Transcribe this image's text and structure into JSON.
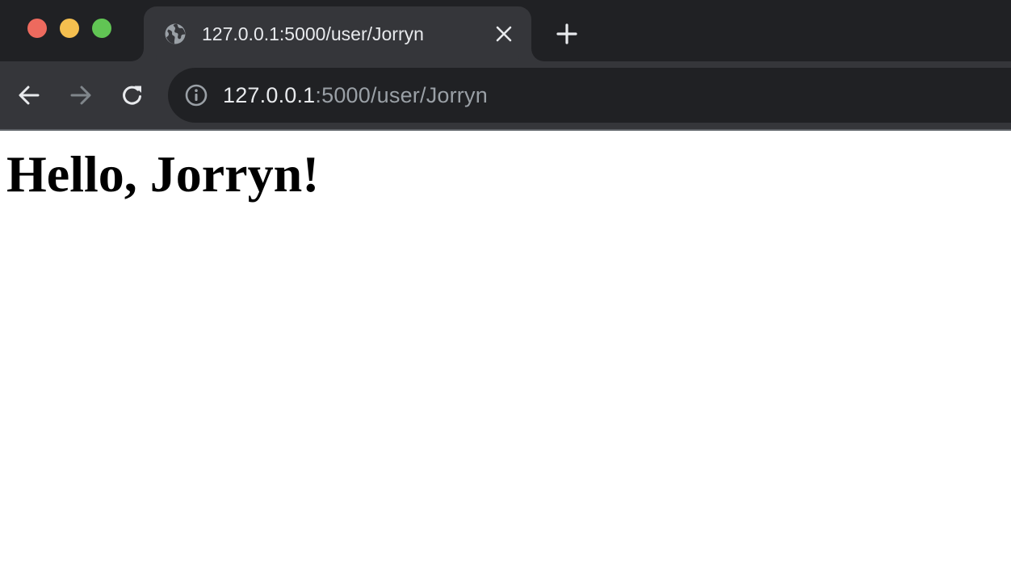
{
  "window": {
    "traffic_lights": {
      "close_color": "#ed6a5e",
      "minimize_color": "#f5bf4f",
      "maximize_color": "#61c554"
    }
  },
  "tab": {
    "title": "127.0.0.1:5000/user/Jorryn",
    "favicon": "globe-icon",
    "close_icon": "close-icon"
  },
  "new_tab": {
    "icon": "plus-icon"
  },
  "toolbar": {
    "back_icon": "arrow-left-icon",
    "forward_icon": "arrow-right-icon",
    "reload_icon": "reload-icon",
    "forward_enabled": false
  },
  "address_bar": {
    "info_icon": "info-icon",
    "url_host": "127.0.0.1",
    "url_rest": ":5000/user/Jorryn"
  },
  "page": {
    "heading": "Hello, Jorryn!"
  },
  "colors": {
    "chrome_dark": "#202124",
    "chrome_mid": "#35363a",
    "text_primary": "#e8eaed",
    "text_muted": "#9aa0a6",
    "icon_disabled": "#80868b"
  }
}
